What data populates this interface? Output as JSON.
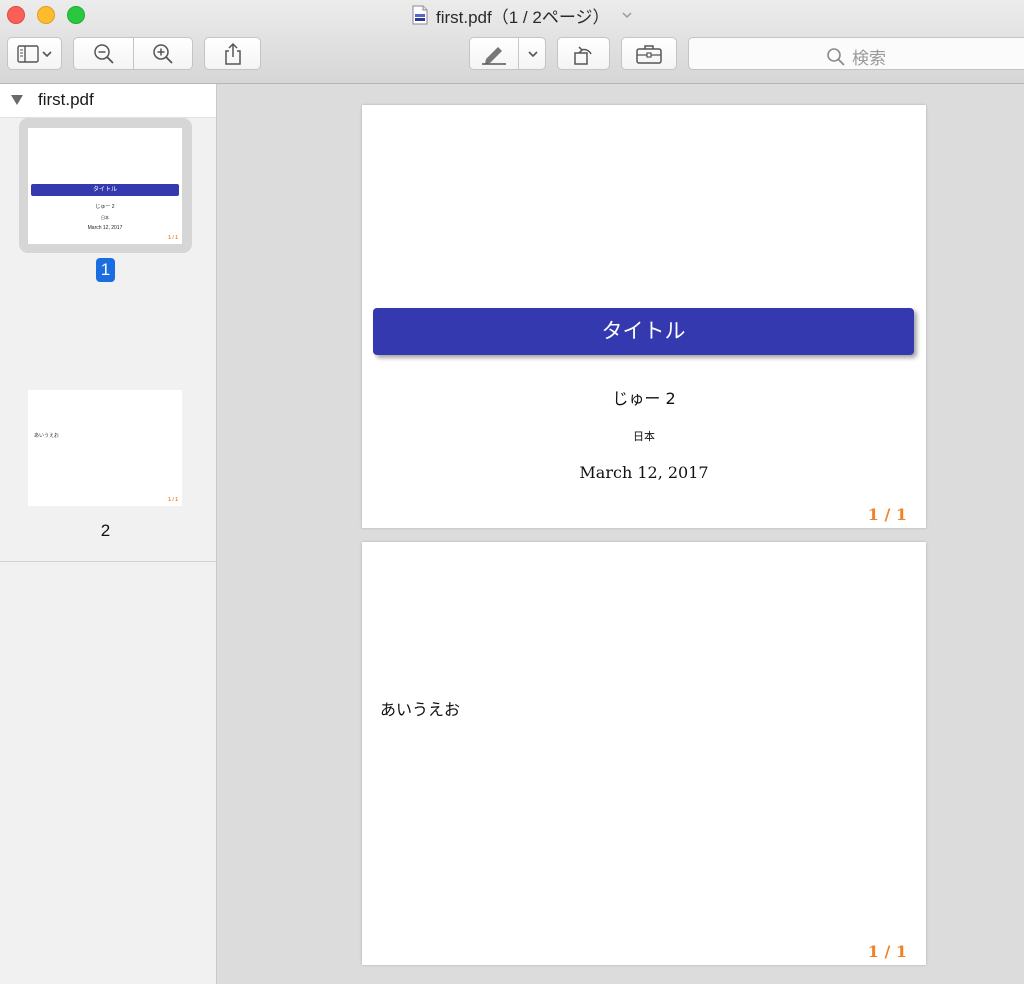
{
  "window": {
    "title": "first.pdf（1 / 2ページ）"
  },
  "toolbar": {
    "sidebar_button_icon": "sidebar-toggle-icon",
    "zoom_out_icon": "zoom-out-icon",
    "zoom_in_icon": "zoom-in-icon",
    "share_icon": "share-icon",
    "markup_icon": "markup-pen-icon",
    "rotate_icon": "rotate-icon",
    "toolbox_icon": "toolbox-icon"
  },
  "search": {
    "placeholder": "検索"
  },
  "sidebar": {
    "file_name": "first.pdf",
    "pages": [
      {
        "label": "1",
        "selected": true,
        "thumb_title": "タイトル",
        "thumb_author": "じゅー 2",
        "thumb_inst": "日本",
        "thumb_date": "March 12, 2017",
        "thumb_num": "1 / 1"
      },
      {
        "label": "2",
        "selected": false,
        "thumb_body": "あいうえお",
        "thumb_num": "1 / 1"
      }
    ]
  },
  "document": {
    "pages": [
      {
        "title": "タイトル",
        "author": "じゅー 2",
        "institute": "日本",
        "date": "March 12, 2017",
        "page_number": "1 / 1"
      },
      {
        "body": "あいうえお",
        "page_number": "1 / 1"
      }
    ]
  },
  "colors": {
    "title_bar": "#3539b0",
    "page_number": "#f0822a",
    "selection": "#1a6ee0"
  }
}
